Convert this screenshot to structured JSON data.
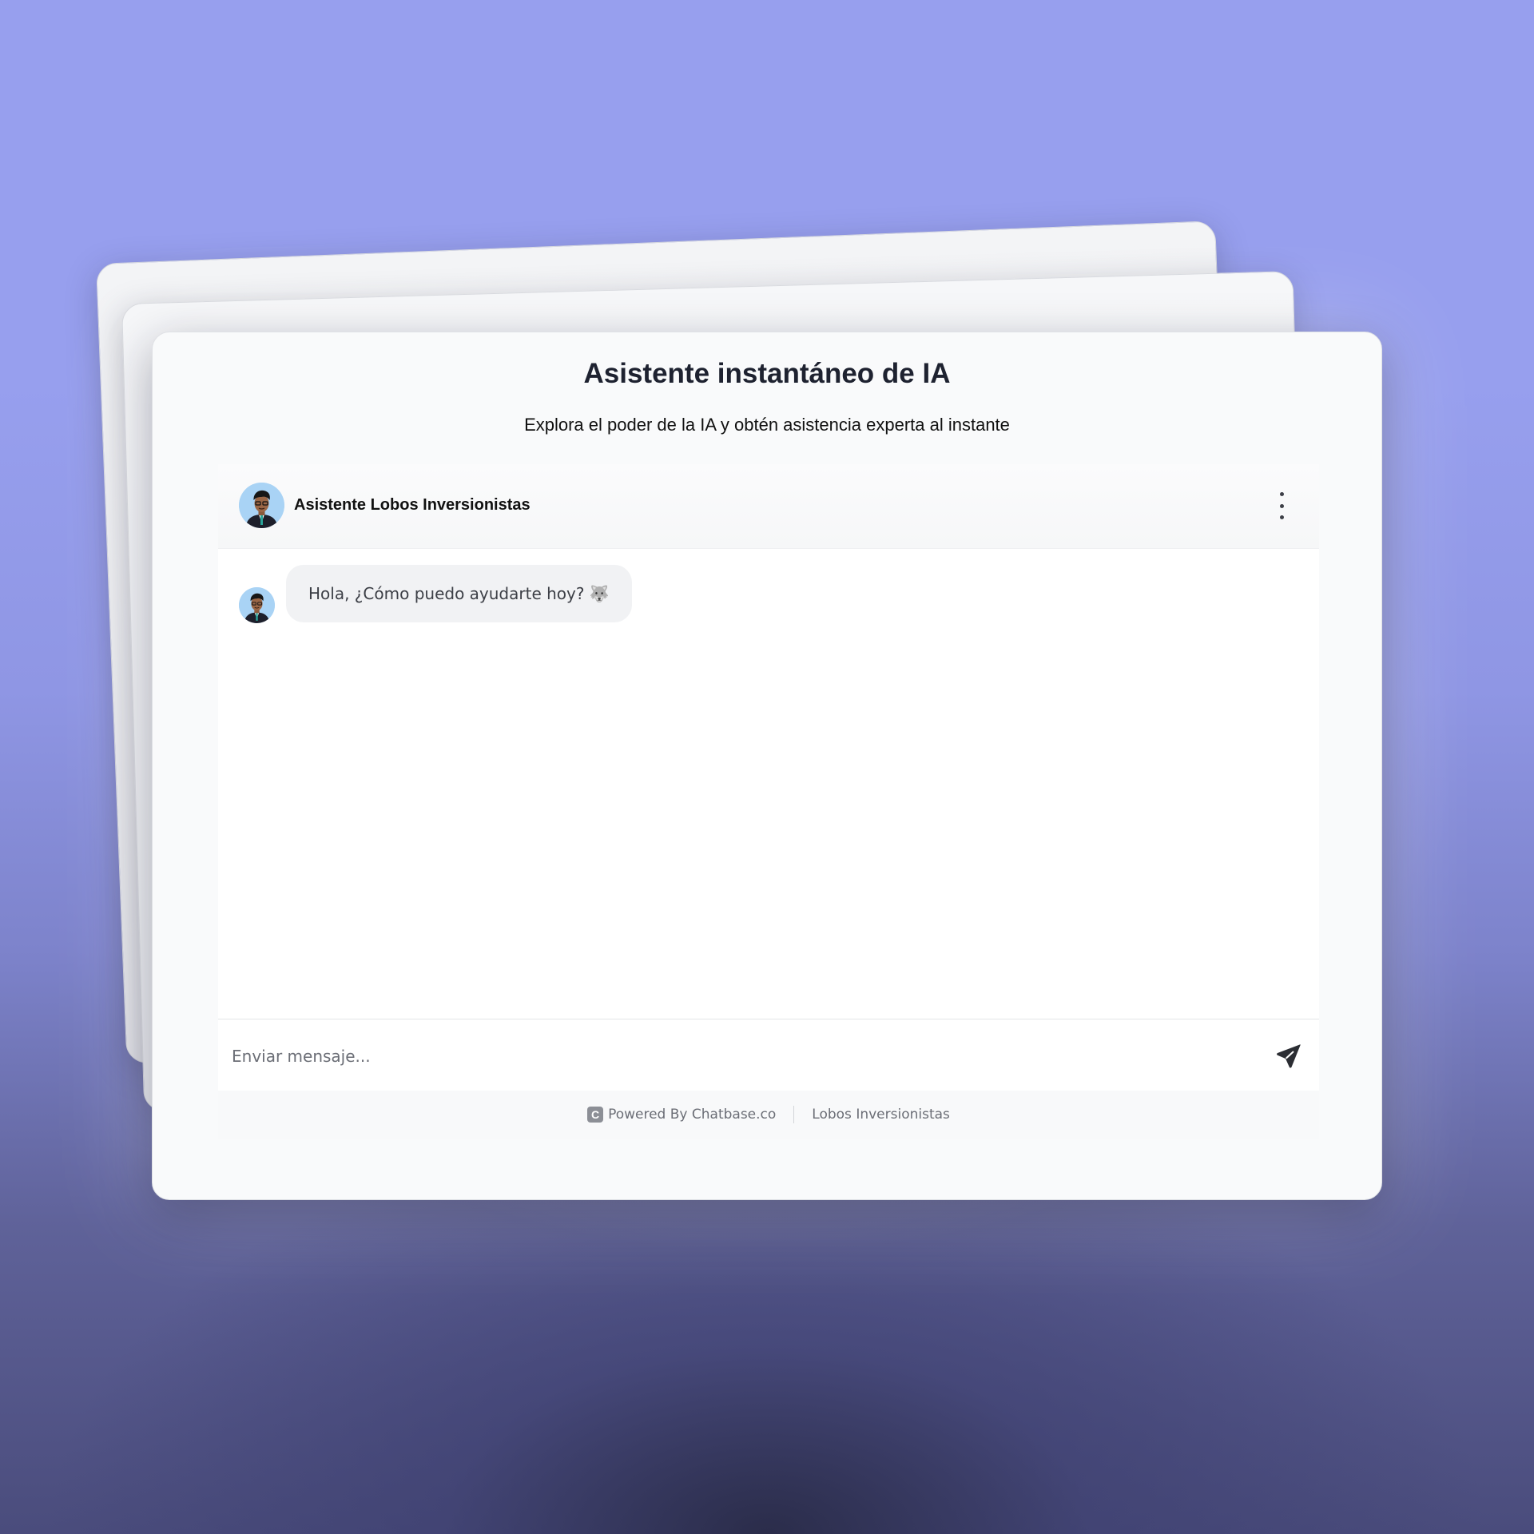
{
  "page": {
    "title": "Asistente instantáneo de IA",
    "subtitle": "Explora el poder de la IA y obtén asistencia experta al instante"
  },
  "chat": {
    "bot_name": "Asistente Lobos Inversionistas",
    "menu_icon": "kebab-menu-icon",
    "messages": [
      {
        "sender": "bot",
        "text": "Hola, ¿Cómo puedo ayudarte hoy? 🐺"
      }
    ],
    "input": {
      "value": "",
      "placeholder": "Enviar mensaje..."
    },
    "send_icon": "send-icon"
  },
  "footer": {
    "powered_by": "Powered By Chatbase.co",
    "logo_letter": "C",
    "brand_link": "Lobos Inversionistas"
  },
  "colors": {
    "background_top": "#979fee",
    "background_bottom": "#4a4c7c",
    "card": "#f9fafb",
    "bubble": "#f1f2f4",
    "avatar_bg": "#a9d3f5"
  }
}
